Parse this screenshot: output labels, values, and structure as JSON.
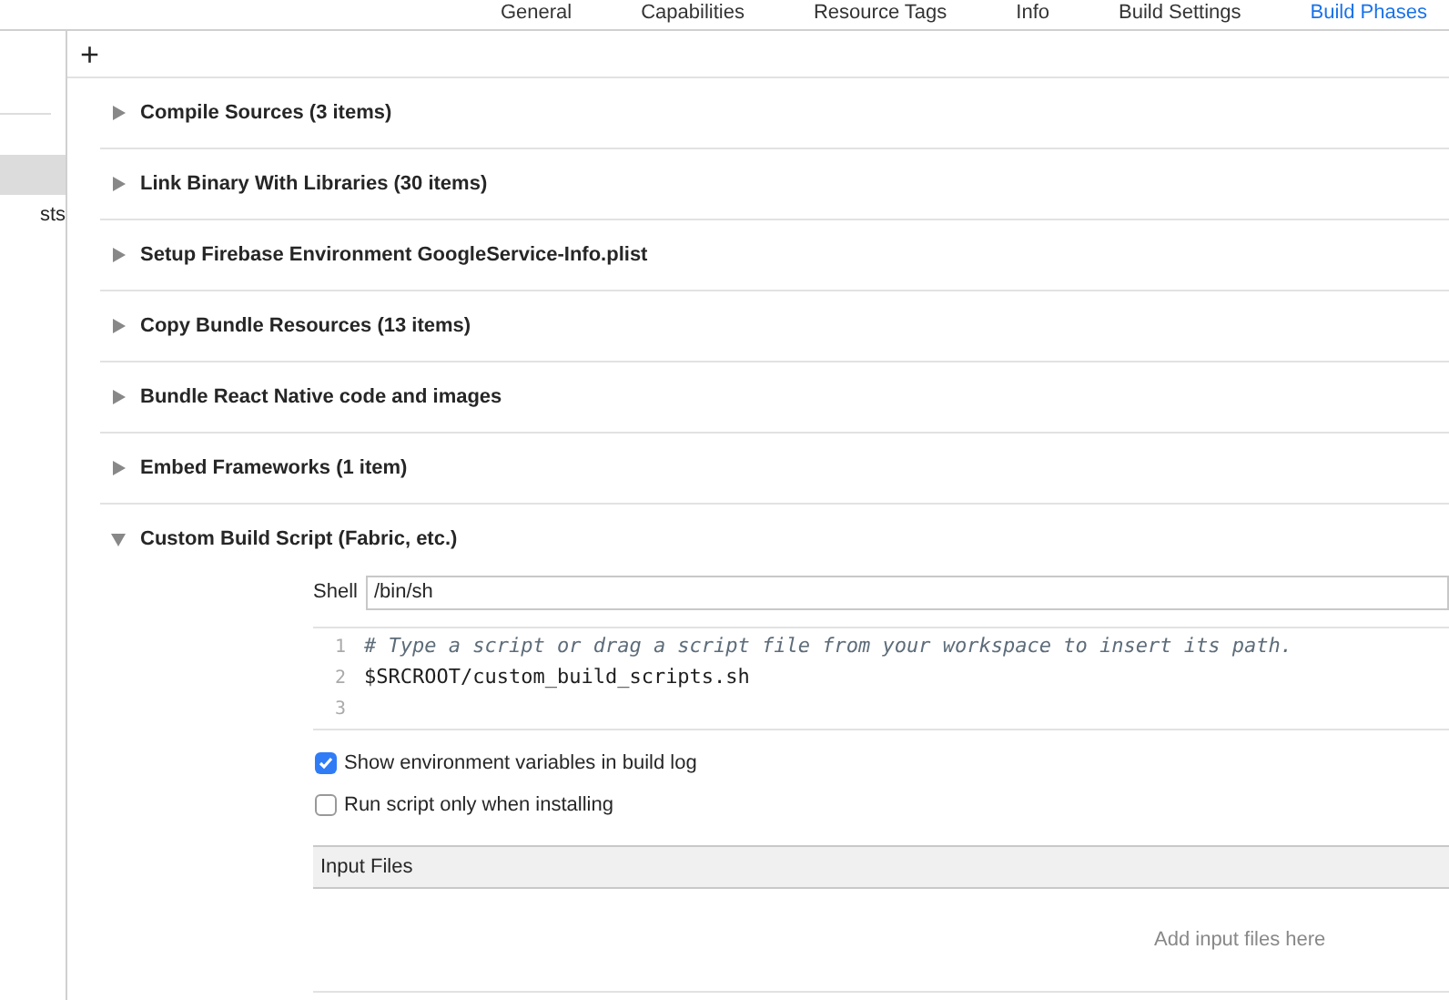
{
  "tabs": [
    {
      "label": "General",
      "selected": false
    },
    {
      "label": "Capabilities",
      "selected": false
    },
    {
      "label": "Resource Tags",
      "selected": false
    },
    {
      "label": "Info",
      "selected": false
    },
    {
      "label": "Build Settings",
      "selected": false
    },
    {
      "label": "Build Phases",
      "selected": true
    }
  ],
  "sidebar": {
    "items": [
      {
        "selected": true
      },
      {
        "label": "sts",
        "selected": false
      }
    ]
  },
  "add_button": "+",
  "phases": [
    {
      "title": "Compile Sources (3 items)",
      "expanded": false
    },
    {
      "title": "Link Binary With Libraries (30 items)",
      "expanded": false
    },
    {
      "title": "Setup Firebase Environment GoogleService-Info.plist",
      "expanded": false
    },
    {
      "title": "Copy Bundle Resources (13 items)",
      "expanded": false
    },
    {
      "title": "Bundle React Native code and images",
      "expanded": false
    },
    {
      "title": "Embed Frameworks (1 item)",
      "expanded": false
    },
    {
      "title": "Custom Build Script (Fabric, etc.)",
      "expanded": true
    }
  ],
  "script": {
    "shell_label": "Shell",
    "shell": "/bin/sh",
    "lines": [
      {
        "number": "1",
        "text": "# Type a script or drag a script file from your workspace to insert its path.",
        "kind": "comment"
      },
      {
        "number": "2",
        "text": "$SRCROOT/custom_build_scripts.sh",
        "kind": "code"
      },
      {
        "number": "3"
      }
    ],
    "options": [
      {
        "label": "Show environment variables in build log",
        "checked": true
      },
      {
        "label": "Run script only when installing",
        "checked": false
      }
    ],
    "input_files": {
      "header": "Input Files",
      "placeholder": "Add input files here"
    }
  }
}
